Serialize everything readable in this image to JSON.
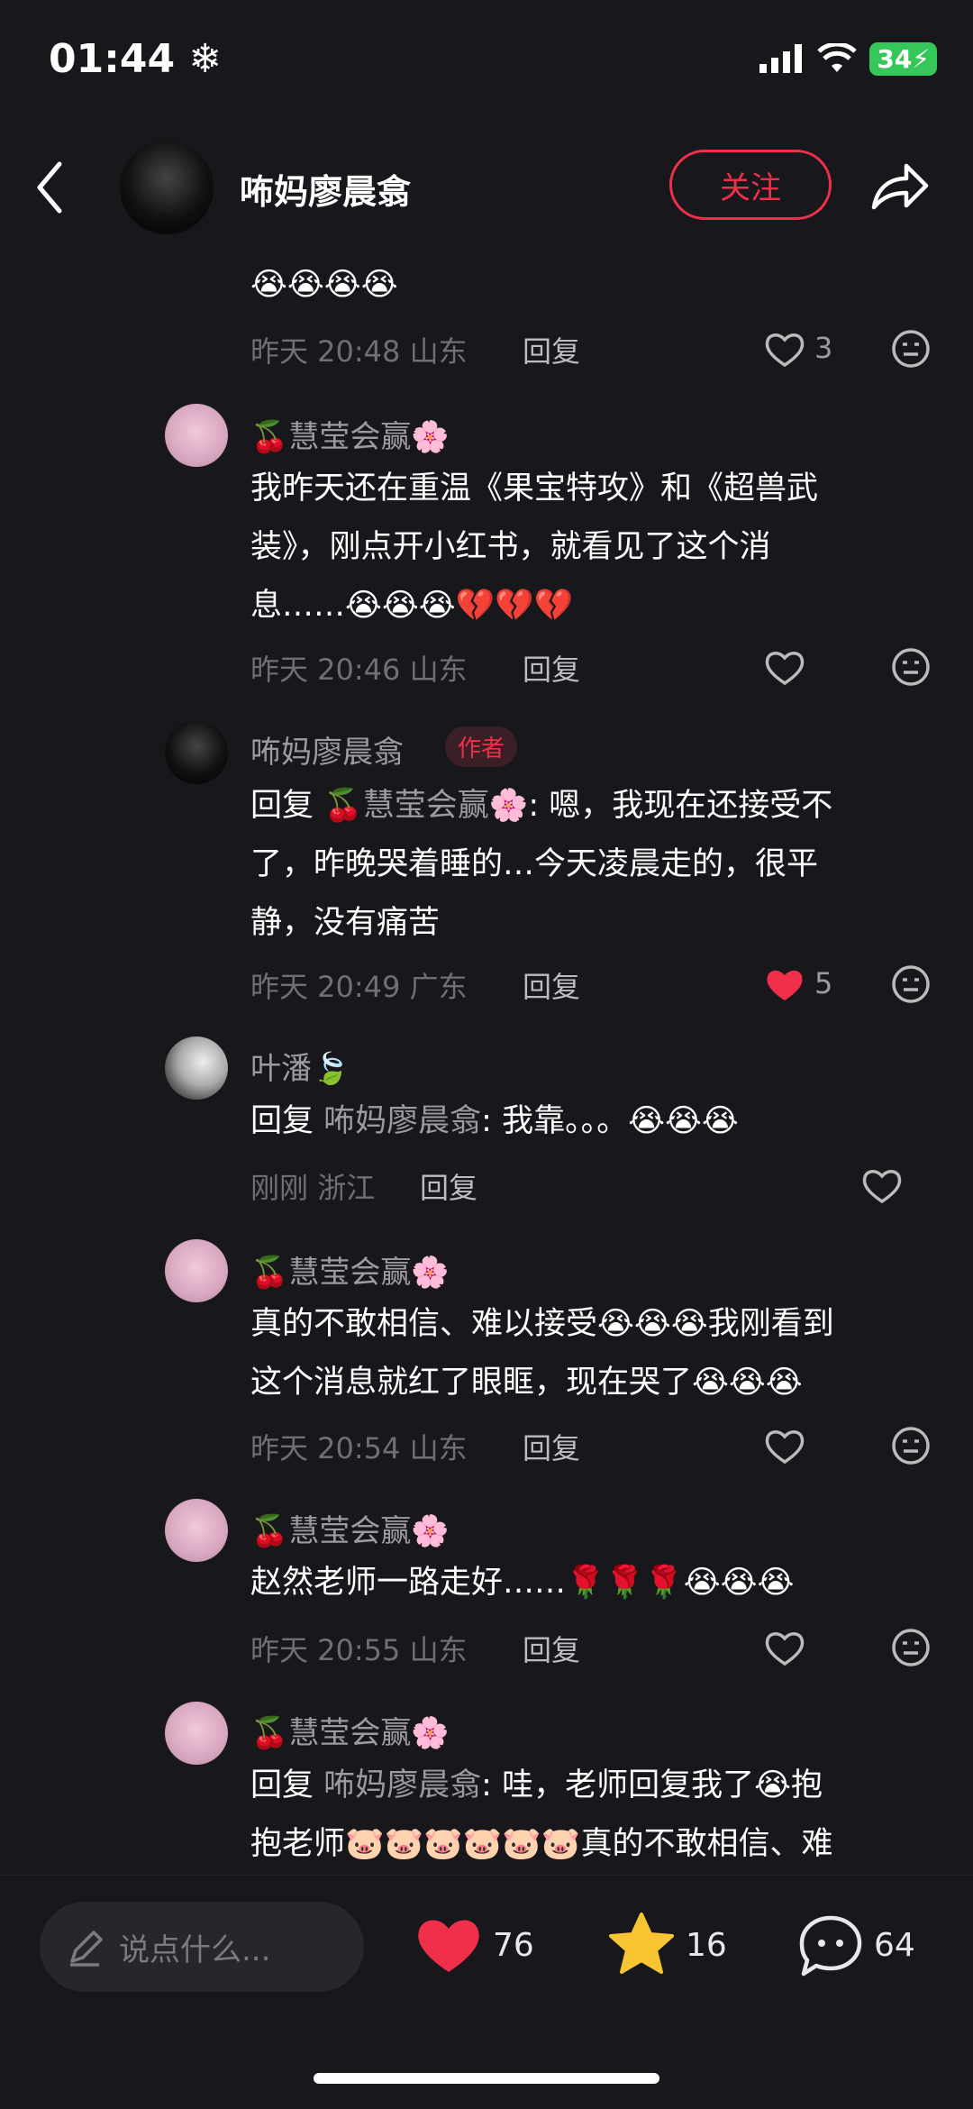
{
  "status": {
    "time": "01:44",
    "battery": "34"
  },
  "header": {
    "username": "咘妈廖晨翕",
    "follow_label": "关注"
  },
  "comments": [
    {
      "body": "😭😭😭😭",
      "time": "昨天 20:48",
      "location": "山东",
      "reply_label": "回复",
      "likes": "3"
    },
    {
      "name": "🍒慧莹会赢🌸",
      "body_lines": [
        "我昨天还在重温《果宝特攻》和《超兽武",
        "装》，刚点开小红书，就看见了这个消",
        "息……😭😭😭💔💔💔"
      ],
      "time": "昨天 20:46",
      "location": "山东",
      "reply_label": "回复"
    },
    {
      "name": "咘妈廖晨翕",
      "author_tag": "作者",
      "reply_prefix": "回复",
      "reply_to": "🍒慧莹会赢🌸",
      "body_lines": [
        ": 嗯，我现在还接受不",
        "了，昨晚哭着睡的…今天凌晨走的，很平",
        "静，没有痛苦"
      ],
      "time": "昨天 20:49",
      "location": "广东",
      "reply_label": "回复",
      "likes": "5"
    },
    {
      "name": "叶潘🍃",
      "reply_prefix": "回复",
      "reply_to": "咘妈廖晨翕",
      "body_tail": ": 我靠。。。😭😭😭",
      "time": "刚刚",
      "location": "浙江",
      "reply_label": "回复"
    },
    {
      "name": "🍒慧莹会赢🌸",
      "body_lines": [
        "真的不敢相信、难以接受😭😭😭我刚看到",
        "这个消息就红了眼眶，现在哭了😭😭😭"
      ],
      "time": "昨天 20:54",
      "location": "山东",
      "reply_label": "回复"
    },
    {
      "name": "🍒慧莹会赢🌸",
      "body": "赵然老师一路走好……🌹🌹🌹😭😭😭",
      "time": "昨天 20:55",
      "location": "山东",
      "reply_label": "回复"
    },
    {
      "name": "🍒慧莹会赢🌸",
      "reply_prefix": "回复",
      "reply_to": "咘妈廖晨翕",
      "body_lines": [
        ": 哇，老师回复我了😭抱",
        "抱老师🐷🐷🐷🐷🐷🐷真的不敢相信、难"
      ]
    }
  ],
  "bottom": {
    "input_placeholder": "说点什么...",
    "likes": "76",
    "stars": "16",
    "comments": "64"
  },
  "colors": {
    "accent": "#f0304a",
    "background": "#17171c",
    "star": "#f7c531"
  }
}
